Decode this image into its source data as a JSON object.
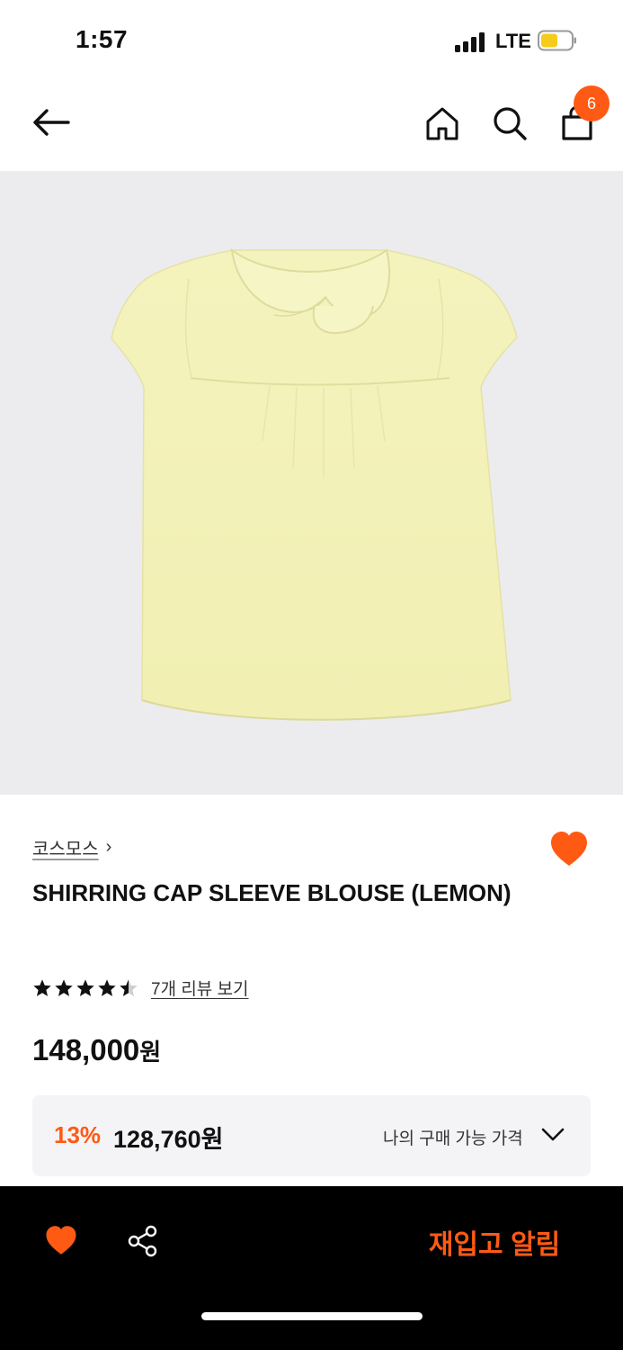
{
  "status_bar": {
    "time": "1:57",
    "network": "LTE"
  },
  "header": {
    "cart_count": "6",
    "icons": [
      "back-arrow-icon",
      "home-icon",
      "search-icon",
      "shopping-bag-icon"
    ]
  },
  "product": {
    "brand": "코스모스",
    "brand_chevron": "›",
    "title": "SHIRRING CAP SLEEVE BLOUSE (LEMON)",
    "rating_value": 4.5,
    "rating_max": 5,
    "review_link": "7개 리뷰 보기",
    "price_number": "148,000",
    "price_unit": "원",
    "discount_rate": "13%",
    "discount_price": "128,760원",
    "my_price_label": "나의 구매 가능 가격",
    "image_subject": "yellow-blouse-image"
  },
  "bottom_bar": {
    "restock_label": "재입고 알림"
  },
  "colors": {
    "accent": "#ff5a14",
    "image_background": "#ececef",
    "blouse": "#f3f2b8",
    "bottom_bar": "#000000"
  }
}
